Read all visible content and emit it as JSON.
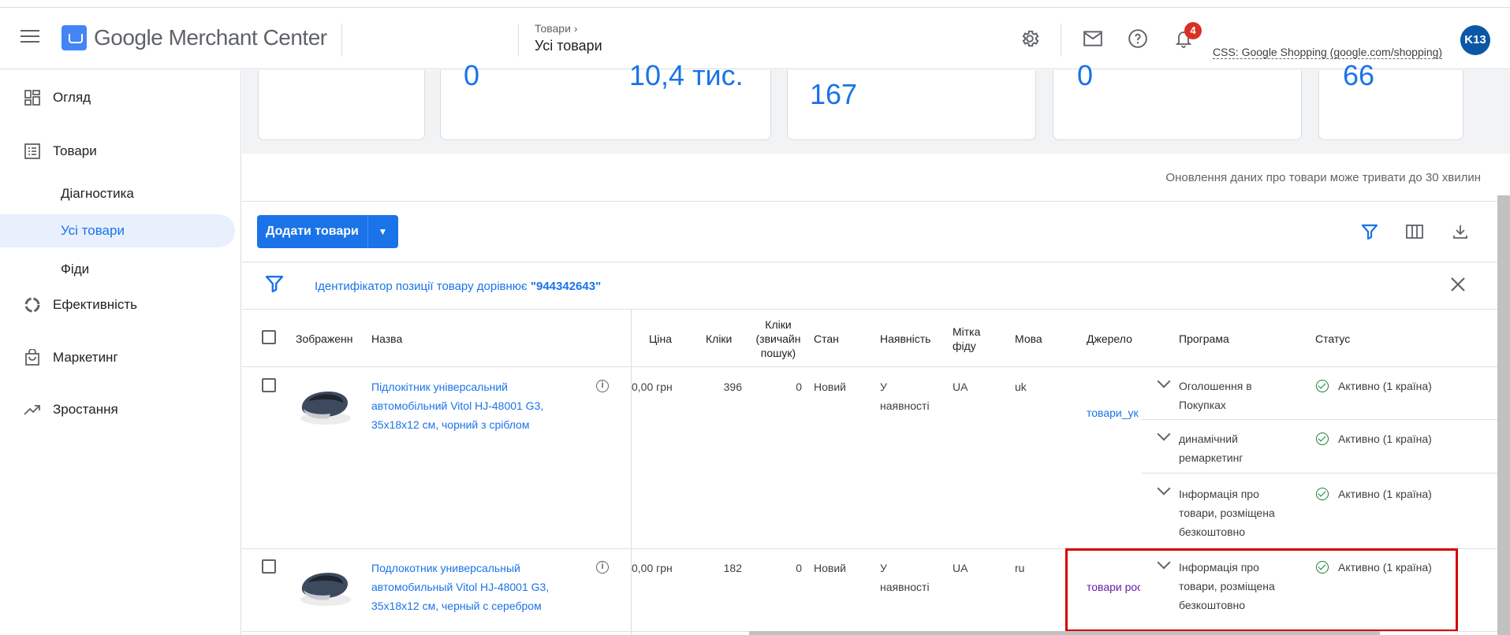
{
  "header": {
    "app_name": "Google Merchant Center",
    "breadcrumb": "Товари",
    "page_title": "Усі товари",
    "notifications_count": "4",
    "css_link": "CSS: Google Shopping (google.com/shopping)",
    "avatar_initials": "K13"
  },
  "sidebar": {
    "items": [
      {
        "label": "Огляд",
        "icon": "dashboard-icon"
      },
      {
        "label": "Товари",
        "icon": "list-icon"
      },
      {
        "label": "Діагностика"
      },
      {
        "label": "Усі товари",
        "active": true
      },
      {
        "label": "Фіди"
      },
      {
        "label": "Ефективність",
        "icon": "donut-chart-icon"
      },
      {
        "label": "Маркетинг",
        "icon": "shopping-bag-icon"
      },
      {
        "label": "Зростання",
        "icon": "trending-up-icon"
      }
    ]
  },
  "summary_cards": [
    {
      "value": "0"
    },
    {
      "value": "10,4 тис."
    },
    {
      "value": "167"
    },
    {
      "value": "0"
    },
    {
      "value": "66"
    }
  ],
  "notice": "Оновлення даних про товари може тривати до 30 хвилин",
  "toolbar": {
    "add_button_label": "Додати товари"
  },
  "filter": {
    "text_prefix": "Ідентифікатор позиції товару дорівнює ",
    "value": "\"944342643\""
  },
  "table": {
    "columns": [
      "Зображенн",
      "Назва",
      "Ціна",
      "Кліки",
      "Кліки (звичайн пошук)",
      "Стан",
      "Наявність",
      "Мітка фіду",
      "Мова",
      "Джерело",
      "Програма",
      "Статус"
    ],
    "col_clicks_organic_1": "Кліки",
    "col_clicks_organic_2": "(звичайн",
    "col_clicks_organic_3": "пошук)",
    "col_feed_label_1": "Мітка",
    "col_feed_label_2": "фіду",
    "rows": [
      {
        "title_1": "Підлокітник універсальний",
        "title_2": "автомобільний Vitol HJ-48001 G3,",
        "title_3": "35x18x12 см, чорний з сріблом",
        "price": "0,00 грн",
        "clicks": "396",
        "organic_clicks": "0",
        "condition": "Новий",
        "availability_1": "У",
        "availability_2": "наявності",
        "feed_label": "UA",
        "language": "uk",
        "source": "товари_ук",
        "programs": [
          {
            "name_1": "Оголошення в",
            "name_2": "Покупках",
            "name_3": "",
            "status": "Активно (1 країна)"
          },
          {
            "name_1": "динамічний",
            "name_2": "ремаркетинг",
            "name_3": "",
            "status": "Активно (1 країна)"
          },
          {
            "name_1": "Інформація про",
            "name_2": "товари, розміщена",
            "name_3": "безкоштовно",
            "status": "Активно (1 країна)"
          }
        ]
      },
      {
        "title_1": "Подлокотник универсальный",
        "title_2": "автомобильный Vitol HJ-48001 G3,",
        "title_3": "35x18x12 см, черный с серебром",
        "price": "0,00 грн",
        "clicks": "182",
        "organic_clicks": "0",
        "condition": "Новий",
        "availability_1": "У",
        "availability_2": "наявності",
        "feed_label": "UA",
        "language": "ru",
        "source": "товари рос",
        "programs": [
          {
            "name_1": "Інформація про",
            "name_2": "товари, розміщена",
            "name_3": "безкоштовно",
            "status": "Активно (1 країна)"
          }
        ]
      }
    ]
  },
  "colors": {
    "accent": "#1a73e8",
    "active_nav_bg": "#e8f0fe",
    "badge": "#d93025",
    "status_ok": "#188038",
    "highlight_box": "#d50000"
  }
}
